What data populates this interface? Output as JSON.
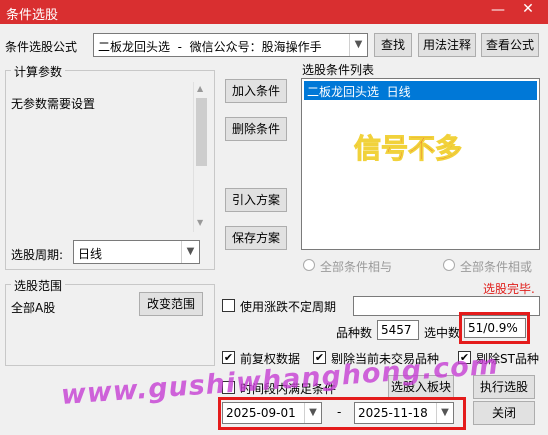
{
  "window": {
    "title": "条件选股",
    "minimize_glyph": "—",
    "close_glyph": "✕"
  },
  "formula": {
    "label": "条件选股公式",
    "value": "二板龙回头选  -  微信公众号：股海操作手",
    "find_button": "查找",
    "usage_button": "用法注释",
    "view_button": "查看公式"
  },
  "params": {
    "legend": "计算参数",
    "text": "无参数需要设置",
    "period_label": "选股周期:",
    "period_value": "日线"
  },
  "actions": {
    "add": "加入条件",
    "delete": "删除条件",
    "import": "引入方案",
    "save": "保存方案"
  },
  "conditions": {
    "legend": "选股条件列表",
    "items": [
      "二板龙回头选  日线"
    ],
    "overlay_note": "信号不多",
    "radio_and": "全部条件相与",
    "radio_or": "全部条件相或"
  },
  "status": {
    "done": "选股完毕.",
    "variety_label": "品种数",
    "variety_value": "5457",
    "selected_label": "选中数",
    "selected_value": "51/0.9%"
  },
  "range": {
    "legend": "选股范围",
    "value": "全部A股",
    "change_button": "改变范围"
  },
  "options": {
    "uncertain_period": "使用涨跌不定周期",
    "forward_adjust": "前复权数据",
    "exclude_untraded": "剔除当前未交易品种",
    "exclude_st": "剔除ST品种",
    "period_all": "时间段内满足条件"
  },
  "bottom": {
    "into_block_button": "选股入板块",
    "execute_button": "执行选股",
    "close_button": "关闭",
    "date_from": "2025-09-01",
    "date_separator": "-",
    "date_to": "2025-11-18"
  },
  "watermark": "www.gushiwhanghong.com",
  "icons": {
    "dropdown": "▼",
    "check": "✔",
    "scroll_up": "▲",
    "scroll_down": "▼"
  },
  "colors": {
    "title_bar": "#d92f30",
    "selection": "#0078d7",
    "highlight_box": "#e41b1b",
    "overlay_text": "#e7262b",
    "overlay_outline": "#f1d23b",
    "watermark": "#c63fd4"
  }
}
